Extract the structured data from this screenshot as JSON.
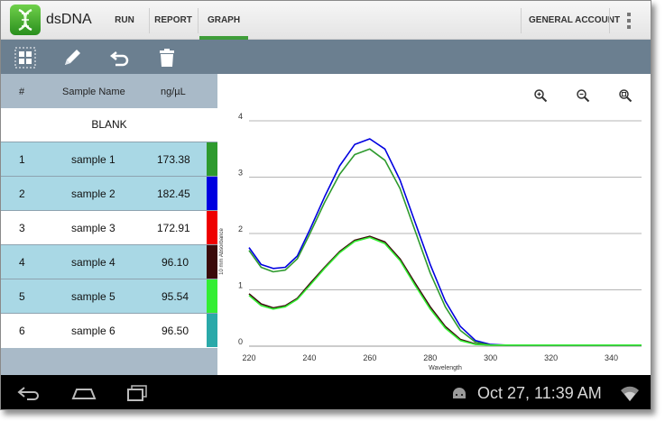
{
  "app": {
    "title": "dsDNA",
    "logo_icon": "dna-logo-icon"
  },
  "nav": {
    "tabs": [
      {
        "label": "RUN",
        "active": false
      },
      {
        "label": "REPORT",
        "active": false
      },
      {
        "label": "GRAPH",
        "active": true
      }
    ],
    "account": "GENERAL ACCOUNT",
    "menu_icon": "overflow-menu-icon"
  },
  "toolbar": {
    "icons": [
      "grid-select-icon",
      "pencil-icon",
      "undo-icon",
      "trash-icon"
    ]
  },
  "table": {
    "headers": {
      "index": "#",
      "name": "Sample Name",
      "conc": "ng/µL"
    },
    "blank_label": "BLANK",
    "rows": [
      {
        "index": "1",
        "name": "sample 1",
        "conc": "173.38",
        "color": "#2e9a2e",
        "selected": true
      },
      {
        "index": "2",
        "name": "sample 2",
        "conc": "182.45",
        "color": "#0000e0",
        "selected": true
      },
      {
        "index": "3",
        "name": "sample 3",
        "conc": "172.91",
        "color": "#ee0000",
        "selected": false
      },
      {
        "index": "4",
        "name": "sample 4",
        "conc": "96.10",
        "color": "#3a0a0a",
        "selected": true
      },
      {
        "index": "5",
        "name": "sample 5",
        "conc": "95.54",
        "color": "#33ee33",
        "selected": true
      },
      {
        "index": "6",
        "name": "sample 6",
        "conc": "96.50",
        "color": "#2aa9a9",
        "selected": false
      }
    ]
  },
  "graph": {
    "zoom_icons": [
      "zoom-in-icon",
      "zoom-out-icon",
      "zoom-reset-icon"
    ]
  },
  "chart_data": {
    "type": "line",
    "ylabel": "10 mm Absorbance",
    "xlabel": "Wavelength",
    "xlim": [
      220,
      350
    ],
    "ylim": [
      0,
      4
    ],
    "xticks": [
      220,
      240,
      260,
      280,
      300,
      320,
      340
    ],
    "yticks": [
      0,
      1,
      2,
      3,
      4
    ],
    "grid": true,
    "series": [
      {
        "color": "#0000e0",
        "x": [
          220,
          224,
          228,
          232,
          236,
          240,
          245,
          250,
          255,
          260,
          265,
          270,
          275,
          280,
          285,
          290,
          295,
          300,
          305,
          310,
          320,
          330,
          340,
          350
        ],
        "y": [
          1.75,
          1.45,
          1.38,
          1.4,
          1.6,
          2.05,
          2.65,
          3.2,
          3.58,
          3.68,
          3.5,
          2.95,
          2.2,
          1.45,
          0.8,
          0.35,
          0.1,
          0.03,
          0.02,
          0.02,
          0.02,
          0.02,
          0.02,
          0.02
        ]
      },
      {
        "color": "#2e9a2e",
        "x": [
          220,
          224,
          228,
          232,
          236,
          240,
          245,
          250,
          255,
          260,
          265,
          270,
          275,
          280,
          285,
          290,
          295,
          300,
          305,
          310,
          320,
          330,
          340,
          350
        ],
        "y": [
          1.7,
          1.4,
          1.32,
          1.35,
          1.55,
          1.98,
          2.55,
          3.05,
          3.4,
          3.5,
          3.3,
          2.8,
          2.05,
          1.3,
          0.7,
          0.28,
          0.07,
          0.02,
          0.02,
          0.02,
          0.02,
          0.02,
          0.02,
          0.02
        ]
      },
      {
        "color": "#3a0a0a",
        "x": [
          220,
          224,
          228,
          232,
          236,
          240,
          245,
          250,
          255,
          260,
          265,
          270,
          275,
          280,
          285,
          290,
          295,
          300,
          305,
          310,
          320,
          330,
          340,
          350
        ],
        "y": [
          0.93,
          0.75,
          0.68,
          0.72,
          0.85,
          1.1,
          1.4,
          1.68,
          1.88,
          1.95,
          1.85,
          1.55,
          1.12,
          0.7,
          0.35,
          0.12,
          0.04,
          0.02,
          0.02,
          0.02,
          0.02,
          0.02,
          0.02,
          0.02
        ]
      },
      {
        "color": "#33ee33",
        "x": [
          220,
          224,
          228,
          232,
          236,
          240,
          245,
          250,
          255,
          260,
          265,
          270,
          275,
          280,
          285,
          290,
          295,
          300,
          305,
          310,
          320,
          330,
          340,
          350
        ],
        "y": [
          0.9,
          0.72,
          0.66,
          0.7,
          0.83,
          1.07,
          1.38,
          1.66,
          1.86,
          1.93,
          1.82,
          1.52,
          1.08,
          0.66,
          0.32,
          0.1,
          0.03,
          0.02,
          0.02,
          0.02,
          0.02,
          0.02,
          0.02,
          0.02
        ]
      }
    ]
  },
  "sysbar": {
    "icons": [
      "back-icon",
      "home-icon",
      "recent-apps-icon"
    ],
    "status_icons": [
      "android-icon",
      "wifi-icon"
    ],
    "clock": "Oct 27, 11:39 AM"
  }
}
